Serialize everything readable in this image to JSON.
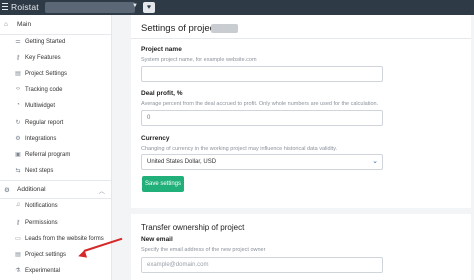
{
  "topbar": {
    "logo": "Roistat",
    "heart_glyph": "♥"
  },
  "sidebar": {
    "main_label": "Main",
    "main_items": [
      {
        "label": "Getting Started",
        "icon": "sliders-icon"
      },
      {
        "label": "Key Features",
        "icon": "key-icon"
      },
      {
        "label": "Project Settings",
        "icon": "file-icon"
      },
      {
        "label": "Tracking code",
        "icon": "code-icon"
      },
      {
        "label": "Multiwidget",
        "icon": "widget-icon"
      },
      {
        "label": "Regular report",
        "icon": "refresh-icon"
      },
      {
        "label": "Integrations",
        "icon": "gear-icon"
      },
      {
        "label": "Referral program",
        "icon": "gift-icon"
      },
      {
        "label": "Next steps",
        "icon": "arrows-icon"
      }
    ],
    "additional_label": "Additional",
    "additional_items": [
      {
        "label": "Notifications",
        "icon": "bell-icon"
      },
      {
        "label": "Permissions",
        "icon": "key-icon"
      },
      {
        "label": "Leads from the website forms",
        "icon": "form-icon"
      },
      {
        "label": "Project settings",
        "icon": "file-icon"
      },
      {
        "label": "Experimental",
        "icon": "flask-icon"
      }
    ]
  },
  "settings": {
    "title": "Settings of project #",
    "project_name_label": "Project name",
    "project_name_hint": "System project name, for example website.com",
    "project_name_value": "",
    "deal_profit_label": "Deal profit, %",
    "deal_profit_hint": "Average percent from the deal accrued to profit. Only whole numbers are used for the calculation.",
    "deal_profit_value": "0",
    "currency_label": "Currency",
    "currency_hint": "Changing of currency in the working project may influence historical data validity.",
    "currency_value": "United States Dollar, USD",
    "save_label": "Save settings"
  },
  "transfer": {
    "title": "Transfer ownership of project",
    "email_label": "New email",
    "email_hint": "Specify the email address of the new project owner",
    "email_placeholder": "example@domain.com"
  },
  "colors": {
    "topbar": "#2f3a47",
    "save_button": "#21b07a",
    "annotation_arrow": "#d62828",
    "dropdown_chevron": "#2b6fb0"
  }
}
